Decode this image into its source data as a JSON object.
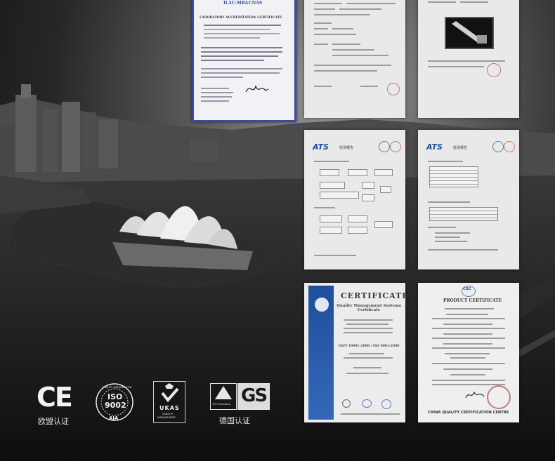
{
  "certificates": {
    "lab_accreditation": {
      "header_logos": [
        "ILAC-MRA",
        "CNAS"
      ],
      "title": "LABORATORY ACCREDITATION CERTIFICATE"
    },
    "test_report_logo": "ATS",
    "test_report_heading": "检测报告",
    "quality_cert": {
      "title": "CERTIFICATE",
      "subtitle": "Quality Management Systems Certificate",
      "standard": "GB/T 19001-2008 / ISO 9001:2008"
    },
    "product_cert": {
      "logo": "CQC",
      "title": "PRODUCT CERTIFICATE",
      "footer": "CHINA QUALITY CERTIFICATION CENTRE"
    }
  },
  "badges": {
    "ce": {
      "mark": "CE",
      "caption": "欧盟认证"
    },
    "iso": {
      "ring_text": "QUALITY ASSURED FOR",
      "mark_top": "ISO",
      "mark_bottom": "9002",
      "sub": "AJA"
    },
    "ukas": {
      "mark": "UKAS",
      "sub_top": "QUALITY",
      "sub_bottom": "MANAGEMENT"
    },
    "gs": {
      "mark": "GS",
      "tuv": "TÜV Rheinland",
      "caption": "德国认证"
    }
  }
}
